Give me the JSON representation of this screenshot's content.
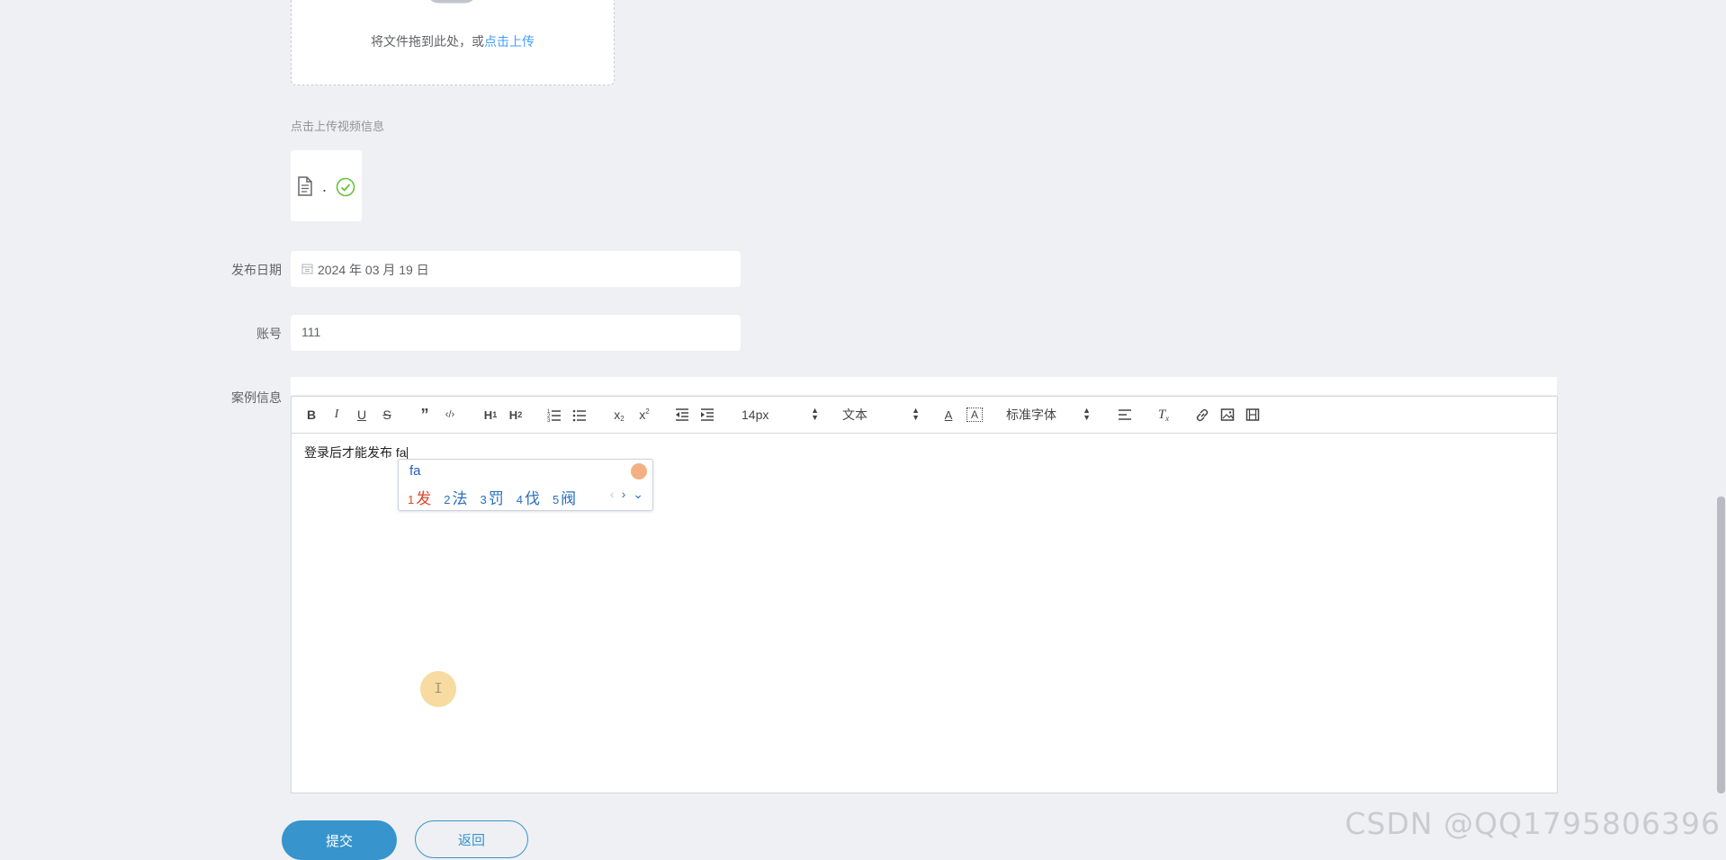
{
  "upload": {
    "drop_text": "将文件拖到此处，或",
    "drop_link": "点击上传",
    "tip": "点击上传视频信息",
    "file_name": "."
  },
  "form": {
    "publish_date_label": "发布日期",
    "publish_date_value": "2024 年 03 月 19 日",
    "account_label": "账号",
    "account_value": "111",
    "case_info_label": "案例信息"
  },
  "editor": {
    "font_size": "14px",
    "header_select": "文本",
    "font_family": "标准字体",
    "content": "登录后才能发布 fa"
  },
  "ime": {
    "composition": "fa",
    "candidates": [
      {
        "n": "1",
        "text": "发"
      },
      {
        "n": "2",
        "text": "法"
      },
      {
        "n": "3",
        "text": "罚"
      },
      {
        "n": "4",
        "text": "伐"
      },
      {
        "n": "5",
        "text": "阀"
      }
    ]
  },
  "buttons": {
    "submit": "提交",
    "back": "返回"
  },
  "watermark": "CSDN @QQ1795806396",
  "colors": {
    "primary": "#3794cc",
    "link": "#409eff",
    "success": "#67c23a",
    "background": "#eef0f3"
  }
}
